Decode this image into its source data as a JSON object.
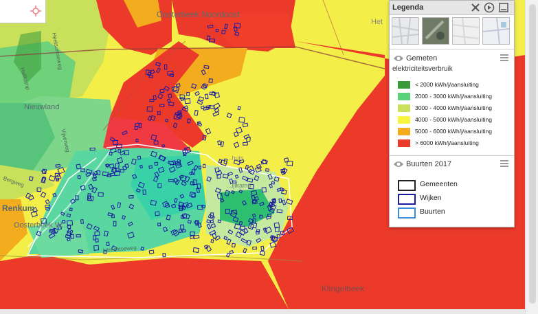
{
  "map": {
    "labels": {
      "oosterbeek_noordoost": "Oosterbeek Noordoost",
      "nieuwland": "Nieuwland",
      "renkum": "Renkum",
      "oosterbeek_west": "Oosterbeek W...",
      "klingelbeek": "Klingelbeek",
      "het": "Het",
      "bathuis": "...huis",
      "dorps": "...ijlkamp"
    },
    "streets": {
      "s1": "Heelsumseweg",
      "s2": "Hallkamp",
      "s3": "Utrechtseweg",
      "s4": "Bergweg",
      "s5": "Vijverweg"
    }
  },
  "legend": {
    "title": "Legenda",
    "layer1": {
      "title": "Gemeten",
      "subtitle": "elektriciteitsverbruik",
      "items": [
        {
          "label": "< 2000 kWh/j/aansluiting",
          "color": "#3a9a3a"
        },
        {
          "label": "2000 - 3000 kWh/j/aansluiting",
          "color": "#5ad27a"
        },
        {
          "label": "3000 - 4000 kWh/j/aansluiting",
          "color": "#c8e05a"
        },
        {
          "label": "4000 - 5000 kWh/j/aansluiting",
          "color": "#f7f542"
        },
        {
          "label": "5000 - 6000 kWh/j/aansluiting",
          "color": "#f2ac1e"
        },
        {
          "label": "> 6000 kWh/j/aansluiting",
          "color": "#ec3a2a"
        }
      ]
    },
    "layer2": {
      "title": "Buurten 2017",
      "items": [
        {
          "label": "Gemeenten",
          "color": "#222222"
        },
        {
          "label": "Wijken",
          "color": "#1a1aa0"
        },
        {
          "label": "Buurten",
          "color": "#3a8ad8"
        }
      ]
    }
  }
}
